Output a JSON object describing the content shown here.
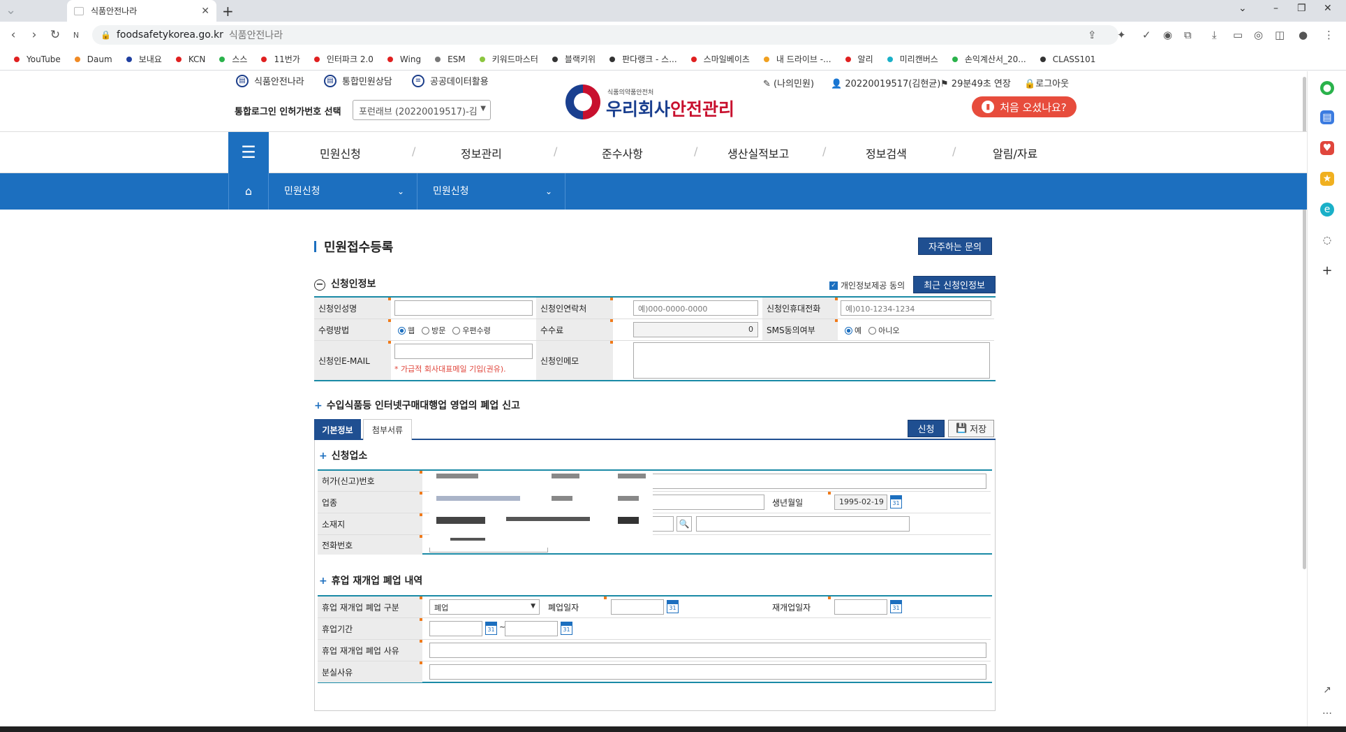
{
  "browser": {
    "tab_title": "식품안전나라",
    "url_domain": "foodsafetykorea.go.kr",
    "url_title": "식품안전나라",
    "bookmarks": [
      {
        "label": "YouTube",
        "color": "#e02020"
      },
      {
        "label": "Daum",
        "color": "#f08a24"
      },
      {
        "label": "보내요",
        "color": "#1f3fa0"
      },
      {
        "label": "KCN",
        "color": "#e02020"
      },
      {
        "label": "스스",
        "color": "#2ab24b"
      },
      {
        "label": "11번가",
        "color": "#e02020"
      },
      {
        "label": "인터파크 2.0",
        "color": "#e02020"
      },
      {
        "label": "Wing",
        "color": "#e02020"
      },
      {
        "label": "ESM",
        "color": "#777777"
      },
      {
        "label": "키워드마스터",
        "color": "#8cc63f"
      },
      {
        "label": "블랙키위",
        "color": "#333333"
      },
      {
        "label": "판다랭크 - 스...",
        "color": "#333333"
      },
      {
        "label": "스마일베이츠",
        "color": "#e02020"
      },
      {
        "label": "내 드라이브 -...",
        "color": "#f0a020"
      },
      {
        "label": "알리",
        "color": "#e02020"
      },
      {
        "label": "미리캔버스",
        "color": "#1ab0c8"
      },
      {
        "label": "손익계산서_20...",
        "color": "#2ab24b"
      },
      {
        "label": "CLASS101",
        "color": "#333333"
      }
    ]
  },
  "header": {
    "links": [
      "식품안전나라",
      "통합민원상담",
      "공공데이터활용"
    ],
    "login_label": "통합로그인 인허가번호 선택",
    "login_select": "포런래브 (20220019517)-김",
    "logo_sub": "식품의약품안전처",
    "logo_main_a": "우리회사",
    "logo_main_b": "안전관리",
    "my_civil": "(나의민원)",
    "user": "20220019517(김현균)",
    "timer": "29분49초 연장",
    "logout": "로그아웃",
    "first_visit": "처음 오셨나요?"
  },
  "nav": {
    "items": [
      "민원신청",
      "정보관리",
      "준수사항",
      "생산실적보고",
      "정보검색",
      "알림/자료"
    ],
    "sub1": "민원신청",
    "sub2": "민원신청"
  },
  "page": {
    "title": "민원접수등록",
    "faq_button": "자주하는 문의",
    "applicant_section": "신청인정보",
    "consent_label": "개인정보제공 동의",
    "recent_button": "최근 신청인정보",
    "fields": {
      "name_label": "신청인성명",
      "contact_label": "신청인연락처",
      "contact_ph": "예)000-0000-0000",
      "mobile_label": "신청인휴대전화",
      "mobile_ph": "예)010-1234-1234",
      "receive_label": "수령방법",
      "receive_opts": [
        "웹",
        "방문",
        "우편수령"
      ],
      "fee_label": "수수료",
      "fee_value": "0",
      "sms_label": "SMS동의여부",
      "sms_opts": [
        "예",
        "아니오"
      ],
      "email_label": "신청인E-MAIL",
      "email_hint": "* 가급적 회사대표메일 기입(권유).",
      "memo_label": "신청인메모"
    },
    "form_section": "수입식품등 인터넷구매대행업 영업의 폐업 신고",
    "tabs": [
      "기본정보",
      "첨부서류"
    ],
    "apply_button": "신청",
    "save_button": "저장",
    "business_section": "신청업소",
    "business": {
      "license_label": "허가(신고)번호",
      "type_label": "업종",
      "birth_label": "생년월일",
      "birth_value": "1995-02-19",
      "address_label": "소재지",
      "phone_label": "전화번호"
    },
    "closure_section": "휴업 재개업 폐업 내역",
    "closure": {
      "kind_label": "휴업 재개업 폐업 구분",
      "kind_value": "폐업",
      "close_date_label": "폐업일자",
      "reopen_date_label": "재개업일자",
      "period_label": "휴업기간",
      "period_sep": "~",
      "reason_label": "휴업 재개업 폐업 사유",
      "lost_label": "분실사유"
    }
  }
}
